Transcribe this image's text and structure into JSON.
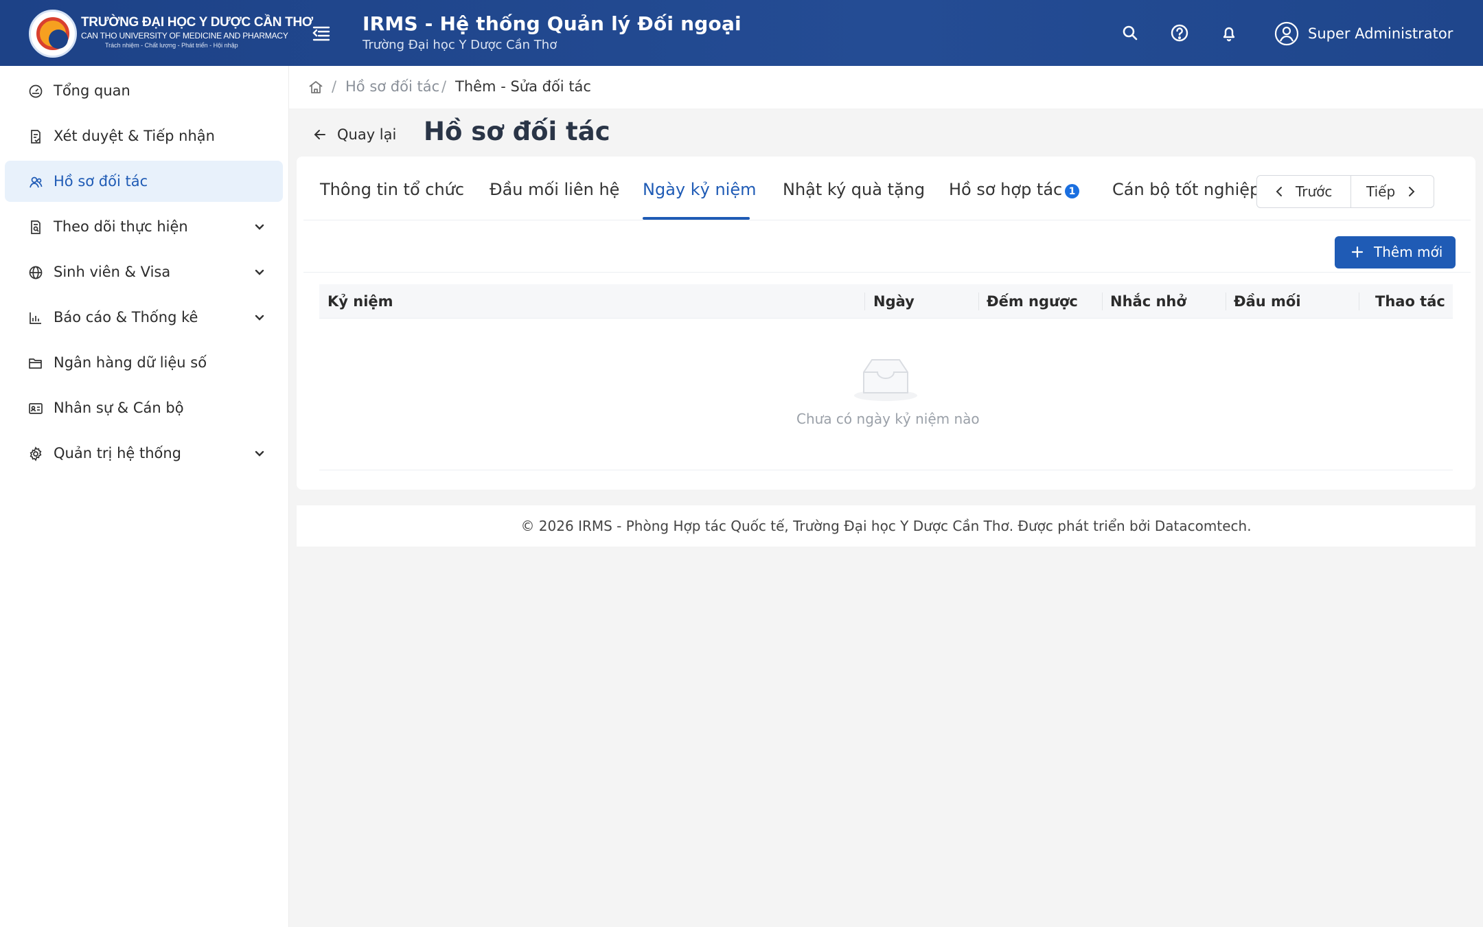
{
  "header": {
    "university_name": "TRƯỜNG ĐẠI HỌC Y DƯỢC CẦN THƠ",
    "university_name_en": "CAN THO UNIVERSITY OF MEDICINE AND PHARMACY",
    "university_motto": "Trách nhiệm - Chất lượng - Phát triển - Hội nhập",
    "app_title": "IRMS - Hệ thống Quản lý Đối ngoại",
    "app_subtitle": "Trường Đại học Y Dược Cần Thơ",
    "user_name": "Super Administrator"
  },
  "sidebar": {
    "items": [
      {
        "label": "Tổng quan",
        "icon": "dashboard-icon",
        "active": false,
        "expandable": false
      },
      {
        "label": "Xét duyệt & Tiếp nhận",
        "icon": "document-check-icon",
        "active": false,
        "expandable": false
      },
      {
        "label": "Hồ sơ đối tác",
        "icon": "users-icon",
        "active": true,
        "expandable": false
      },
      {
        "label": "Theo dõi thực hiện",
        "icon": "document-search-icon",
        "active": false,
        "expandable": true
      },
      {
        "label": "Sinh viên & Visa",
        "icon": "globe-icon",
        "active": false,
        "expandable": true
      },
      {
        "label": "Báo cáo & Thống kê",
        "icon": "bar-chart-icon",
        "active": false,
        "expandable": true
      },
      {
        "label": "Ngân hàng dữ liệu số",
        "icon": "folder-icon",
        "active": false,
        "expandable": false
      },
      {
        "label": "Nhân sự & Cán bộ",
        "icon": "id-card-icon",
        "active": false,
        "expandable": false
      },
      {
        "label": "Quản trị hệ thống",
        "icon": "gear-icon",
        "active": false,
        "expandable": true
      }
    ]
  },
  "breadcrumb": {
    "items": [
      "Hồ sơ đối tác",
      "Thêm - Sửa đối tác"
    ],
    "separator": "/"
  },
  "page": {
    "back_label": "Quay lại",
    "title": "Hồ sơ đối tác"
  },
  "tabs": {
    "items": [
      {
        "label": "Thông tin tổ chức"
      },
      {
        "label": "Đầu mối liên hệ"
      },
      {
        "label": "Ngày kỷ niệm"
      },
      {
        "label": "Nhật ký quà tặng"
      },
      {
        "label": "Hồ sơ hợp tác",
        "badge": "1"
      },
      {
        "label": "Cán bộ tốt nghiệp"
      }
    ],
    "active_index": 2,
    "prev_label": "Trước",
    "next_label": "Tiếp"
  },
  "toolbar": {
    "add_label": "Thêm mới"
  },
  "table": {
    "columns": [
      "Kỷ niệm",
      "Ngày",
      "Đếm ngược",
      "Nhắc nhở",
      "Đầu mối",
      "Thao tác"
    ],
    "rows": [],
    "empty_text": "Chưa có ngày kỷ niệm nào"
  },
  "footer": {
    "text": "© 2026 IRMS - Phòng Hợp tác Quốc tế, Trường Đại học Y Dược Cần Thơ. Được phát triển bởi Datacomtech."
  },
  "colors": {
    "header_bg": "#1f468c",
    "primary": "#1f5bb5",
    "active_nav_bg": "#e8f1fb",
    "badge": "#1a6fe0"
  }
}
